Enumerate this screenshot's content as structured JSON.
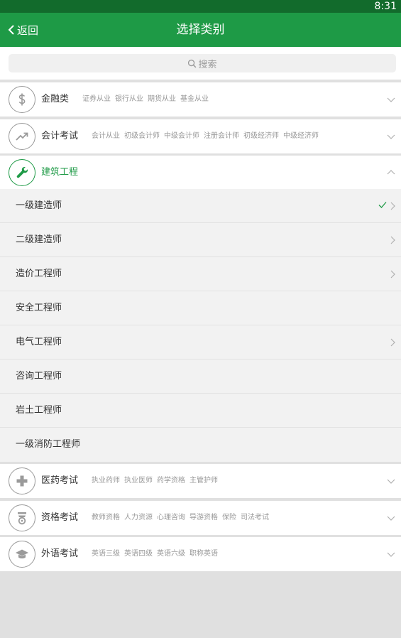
{
  "status_bar": {
    "time": "8:31"
  },
  "header": {
    "back_label": "返回",
    "title": "选择类别"
  },
  "search": {
    "placeholder": "搜索"
  },
  "categories": [
    {
      "name": "金融类",
      "icon": "dollar-icon",
      "expanded": false,
      "tags": [
        "证券从业",
        "银行从业",
        "期货从业",
        "基金从业"
      ]
    },
    {
      "name": "会计考试",
      "icon": "trend-up-icon",
      "expanded": false,
      "tags": [
        "会计从业",
        "初级会计师",
        "中级会计师",
        "注册会计师",
        "初级经济师",
        "中级经济师"
      ]
    },
    {
      "name": "建筑工程",
      "icon": "wrench-icon",
      "expanded": true,
      "tags": []
    },
    {
      "name": "医药考试",
      "icon": "medical-cross-icon",
      "expanded": false,
      "tags": [
        "执业药师",
        "执业医师",
        "药学资格",
        "主管护师"
      ]
    },
    {
      "name": "资格考试",
      "icon": "badge-icon",
      "expanded": false,
      "tags": [
        "教师资格",
        "人力资源",
        "心理咨询",
        "导游资格",
        "保险",
        "司法考试"
      ]
    },
    {
      "name": "外语考试",
      "icon": "graduation-cap-icon",
      "expanded": false,
      "tags": [
        "英语三级",
        "英语四级",
        "英语六级",
        "职称英语"
      ]
    }
  ],
  "construction_items": [
    {
      "label": "一级建造师",
      "selected": true,
      "has_arrow": true
    },
    {
      "label": "二级建造师",
      "selected": false,
      "has_arrow": true
    },
    {
      "label": "造价工程师",
      "selected": false,
      "has_arrow": true
    },
    {
      "label": "安全工程师",
      "selected": false,
      "has_arrow": false
    },
    {
      "label": "电气工程师",
      "selected": false,
      "has_arrow": true
    },
    {
      "label": "咨询工程师",
      "selected": false,
      "has_arrow": false
    },
    {
      "label": "岩土工程师",
      "selected": false,
      "has_arrow": false
    },
    {
      "label": "一级消防工程师",
      "selected": false,
      "has_arrow": false
    }
  ],
  "colors": {
    "primary": "#1e9a46",
    "status_bar": "#126b2c",
    "icon_gray": "#9a9a9a",
    "background": "#e0e0e0"
  }
}
